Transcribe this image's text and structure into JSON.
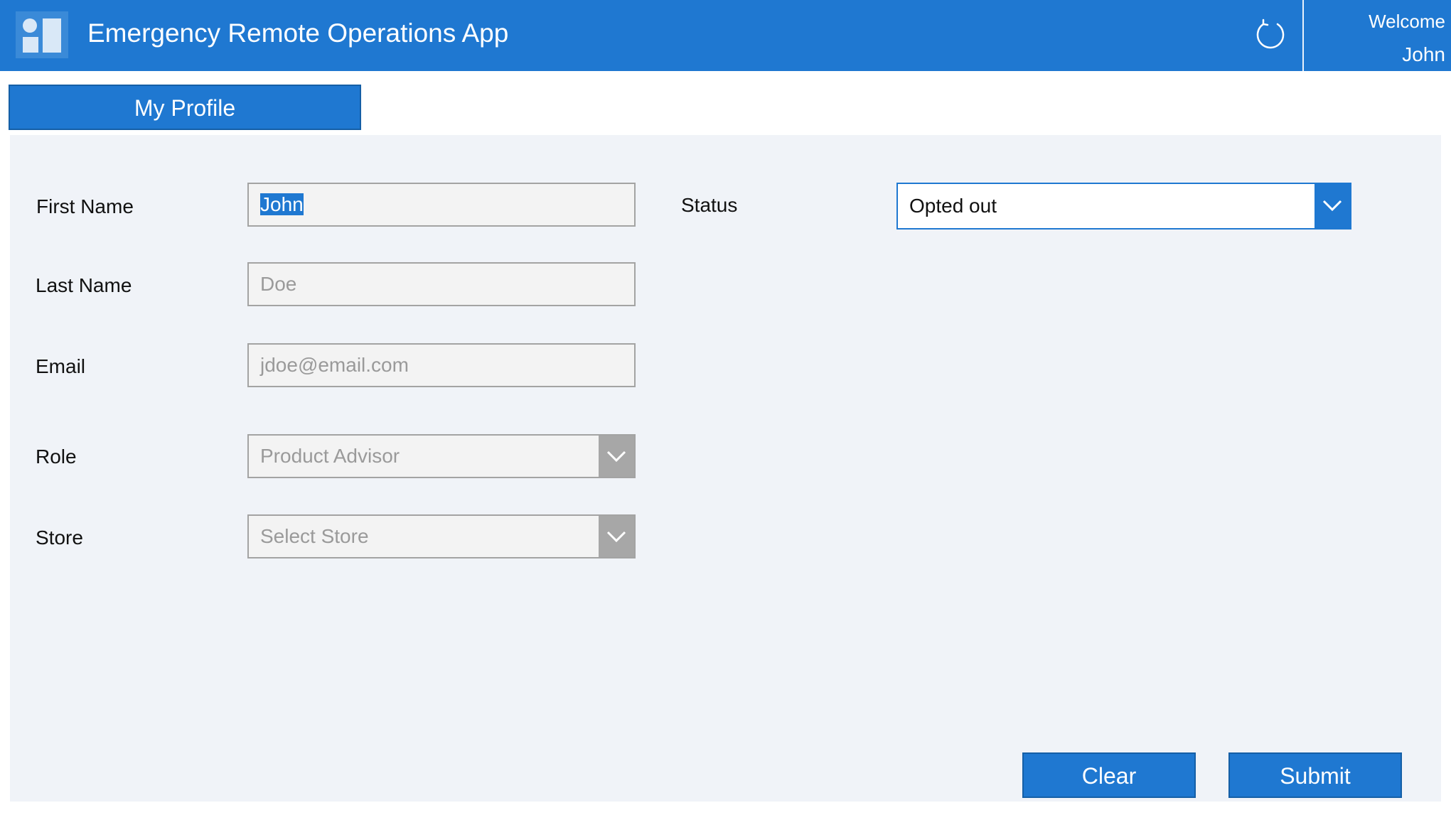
{
  "header": {
    "app_title": "Emergency Remote Operations App",
    "welcome_text": "Welcome",
    "user_name": "John",
    "logo_icon": "app-logo-icon",
    "refresh_icon": "refresh-icon"
  },
  "tabs": [
    {
      "label": "My Profile",
      "active": true
    }
  ],
  "form": {
    "first_name": {
      "label": "First Name",
      "value": "John"
    },
    "last_name": {
      "label": "Last Name",
      "placeholder": "Doe"
    },
    "email": {
      "label": "Email",
      "placeholder": "jdoe@email.com"
    },
    "role": {
      "label": "Role",
      "placeholder": "Product Advisor",
      "icon": "chevron-down-icon"
    },
    "store": {
      "label": "Store",
      "placeholder": "Select Store",
      "icon": "chevron-down-icon"
    },
    "status": {
      "label": "Status",
      "value": "Opted out",
      "icon": "chevron-down-icon"
    }
  },
  "actions": {
    "clear_label": "Clear",
    "submit_label": "Submit"
  },
  "colors": {
    "accent": "#1f78d1",
    "panel_bg": "#f0f3f8",
    "field_bg": "#f3f3f3",
    "field_border": "#a3a3a3"
  }
}
